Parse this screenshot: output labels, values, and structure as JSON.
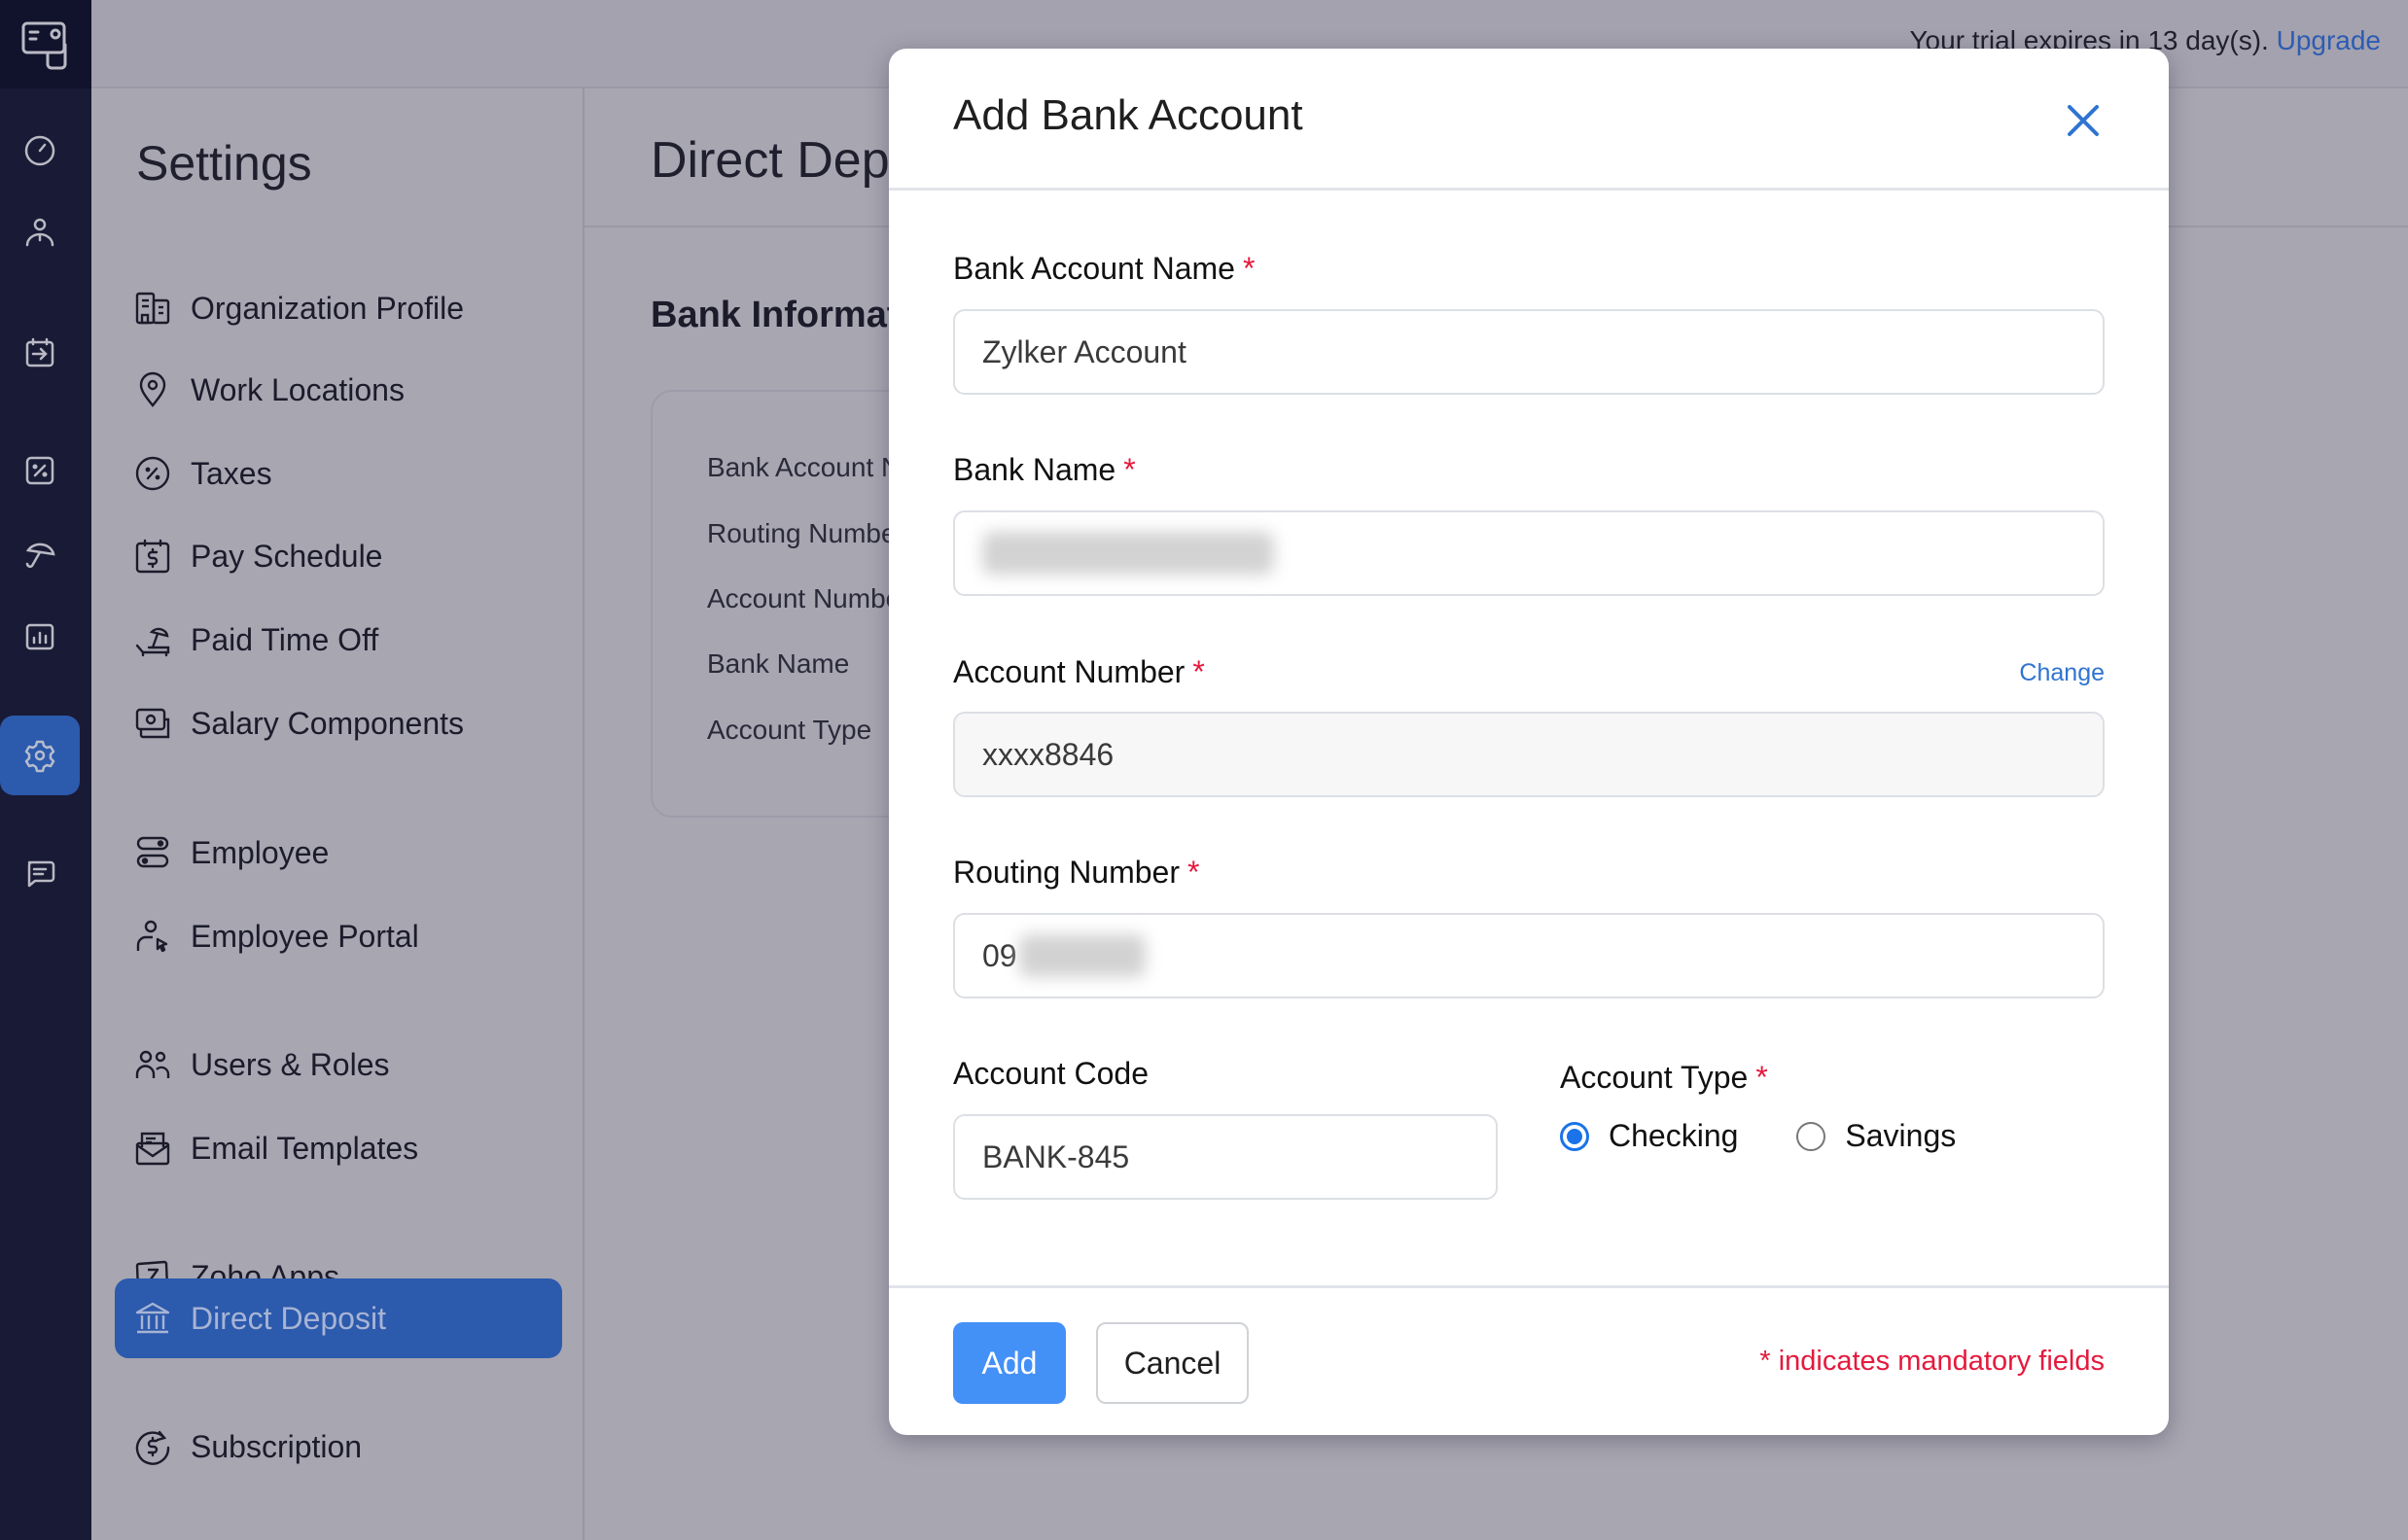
{
  "topbar": {
    "trial_text": "Your trial expires in 13 day(s).",
    "upgrade_label": "Upgrade"
  },
  "rail": {
    "items": [
      {
        "icon": "dashboard-gauge-icon"
      },
      {
        "icon": "employees-person-icon"
      },
      {
        "icon": "pay-runs-calendar-icon"
      },
      {
        "icon": "taxes-percent-icon"
      },
      {
        "icon": "leave-umbrella-icon"
      },
      {
        "icon": "reports-chart-icon"
      },
      {
        "icon": "settings-gear-icon",
        "active": true
      },
      {
        "icon": "feedback-chat-icon"
      }
    ]
  },
  "settings": {
    "title": "Settings",
    "items": [
      {
        "label": "Organization Profile",
        "icon": "building-icon"
      },
      {
        "label": "Work Locations",
        "icon": "location-pin-icon"
      },
      {
        "label": "Taxes",
        "icon": "percent-circle-icon"
      },
      {
        "label": "Pay Schedule",
        "icon": "calendar-dollar-icon"
      },
      {
        "label": "Paid Time Off",
        "icon": "beach-chair-icon"
      },
      {
        "label": "Salary Components",
        "icon": "money-stack-icon"
      },
      {
        "label": "Employee",
        "icon": "toggles-icon"
      },
      {
        "label": "Employee Portal",
        "icon": "person-pointer-icon"
      },
      {
        "label": "Users & Roles",
        "icon": "users-icon"
      },
      {
        "label": "Email Templates",
        "icon": "envelope-open-icon"
      },
      {
        "label": "Zoho Apps",
        "icon": "zoho-z-icon"
      },
      {
        "label": "Direct Deposit",
        "icon": "bank-icon",
        "active": true
      },
      {
        "label": "Subscription",
        "icon": "dollar-refresh-icon"
      }
    ]
  },
  "main": {
    "title": "Direct Deposit",
    "section_title": "Bank Information",
    "card_rows": [
      "Bank Account Name",
      "Routing Number",
      "Account Number",
      "Bank Name",
      "Account Type"
    ]
  },
  "modal": {
    "title": "Add Bank Account",
    "fields": {
      "bank_account_name": {
        "label": "Bank Account Name",
        "value": "Zylker Account",
        "required": true
      },
      "bank_name": {
        "label": "Bank Name",
        "value": "",
        "redacted": true,
        "required": true
      },
      "account_number": {
        "label": "Account Number",
        "value": "xxxx8846",
        "required": true,
        "change_label": "Change"
      },
      "routing_number": {
        "label": "Routing Number",
        "value": "09",
        "redacted_suffix": true,
        "required": true
      },
      "account_code": {
        "label": "Account Code",
        "value": "BANK-845",
        "required": false
      },
      "account_type": {
        "label": "Account Type",
        "required": true,
        "options": [
          "Checking",
          "Savings"
        ],
        "selected": "Checking"
      }
    },
    "required_mark": "*",
    "add_label": "Add",
    "cancel_label": "Cancel",
    "mandatory_note": "* indicates mandatory fields"
  },
  "colors": {
    "primary": "#4390f7",
    "active_nav": "#2c5aad",
    "required": "#e5193d",
    "link": "#2f74d0"
  }
}
